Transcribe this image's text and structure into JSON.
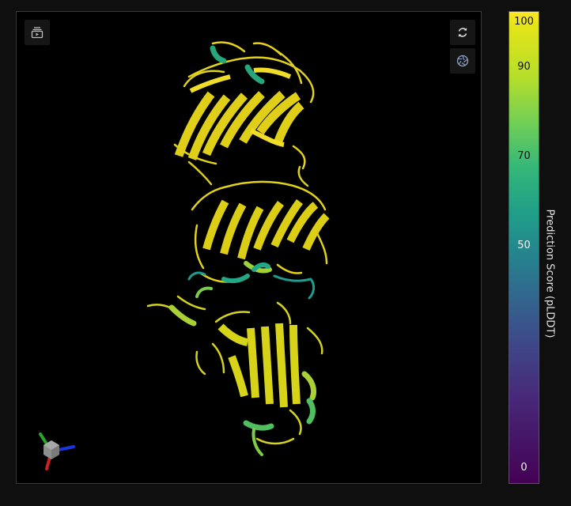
{
  "viewer": {
    "toolbar": {
      "animation_icon": "play-stack-icon",
      "reset_icon": "rotate-icon",
      "screenshot_icon": "camera-aperture-icon"
    },
    "axes_icon": "xyz-axes-icon"
  },
  "colorbar": {
    "title": "Prediction Score (pLDDT)",
    "ticks": [
      "100",
      "90",
      "70",
      "50",
      "0"
    ],
    "colors": {
      "very_high": "#fde725",
      "confident": "#6ece58",
      "low": "#1f9e89",
      "very_low": "#440154"
    }
  }
}
